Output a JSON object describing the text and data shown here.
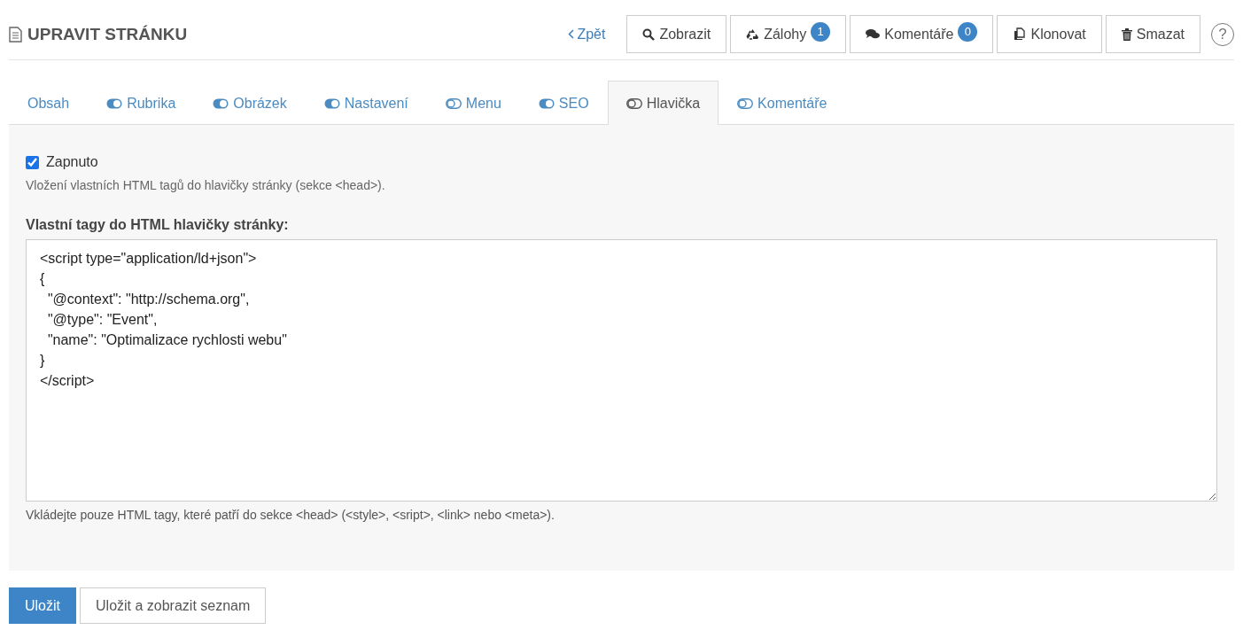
{
  "header": {
    "title": "UPRAVIT STRÁNKU",
    "back_link": "Zpět",
    "help": "?",
    "buttons": [
      {
        "kind": "search",
        "label": "Zobrazit"
      },
      {
        "kind": "recycle",
        "label": "Zálohy",
        "badge": "1"
      },
      {
        "kind": "comments",
        "label": "Komentáře",
        "badge": "0"
      },
      {
        "kind": "clone",
        "label": "Klonovat"
      },
      {
        "kind": "trash",
        "label": "Smazat"
      }
    ]
  },
  "tabs": [
    {
      "kind": "plain",
      "label": "Obsah",
      "selected": false
    },
    {
      "kind": "toggle",
      "label": "Rubrika",
      "on": true,
      "selected": false
    },
    {
      "kind": "toggle",
      "label": "Obrázek",
      "on": true,
      "selected": false
    },
    {
      "kind": "toggle",
      "label": "Nastavení",
      "on": true,
      "selected": false
    },
    {
      "kind": "toggle",
      "label": "Menu",
      "on": false,
      "selected": false
    },
    {
      "kind": "toggle",
      "label": "SEO",
      "on": true,
      "selected": false
    },
    {
      "kind": "toggle",
      "label": "Hlavička",
      "on": false,
      "selected": true
    },
    {
      "kind": "toggle",
      "label": "Komentáře",
      "on": false,
      "selected": false
    }
  ],
  "panel": {
    "enabled": {
      "label": "Zapnuto",
      "checked": true
    },
    "description": "Vložení vlastních HTML tagů do hlavičky stránky (sekce <head>).",
    "field_label": "Vlastní tagy do HTML hlavičky stránky:",
    "field_value": "<script type=\"application/ld+json\">\n{\n  \"@context\": \"http://schema.org\",\n  \"@type\": \"Event\",\n  \"name\": \"Optimalizace rychlosti webu\"\n}\n</script>",
    "hint": "Vkládejte pouze HTML tagy, které patří do sekce <head> (<style>, <sript>, <link> nebo <meta>)."
  },
  "actions": [
    {
      "kind": "primary",
      "label": "Uložit"
    },
    {
      "kind": "secondary",
      "label": "Uložit a zobrazit seznam"
    }
  ]
}
